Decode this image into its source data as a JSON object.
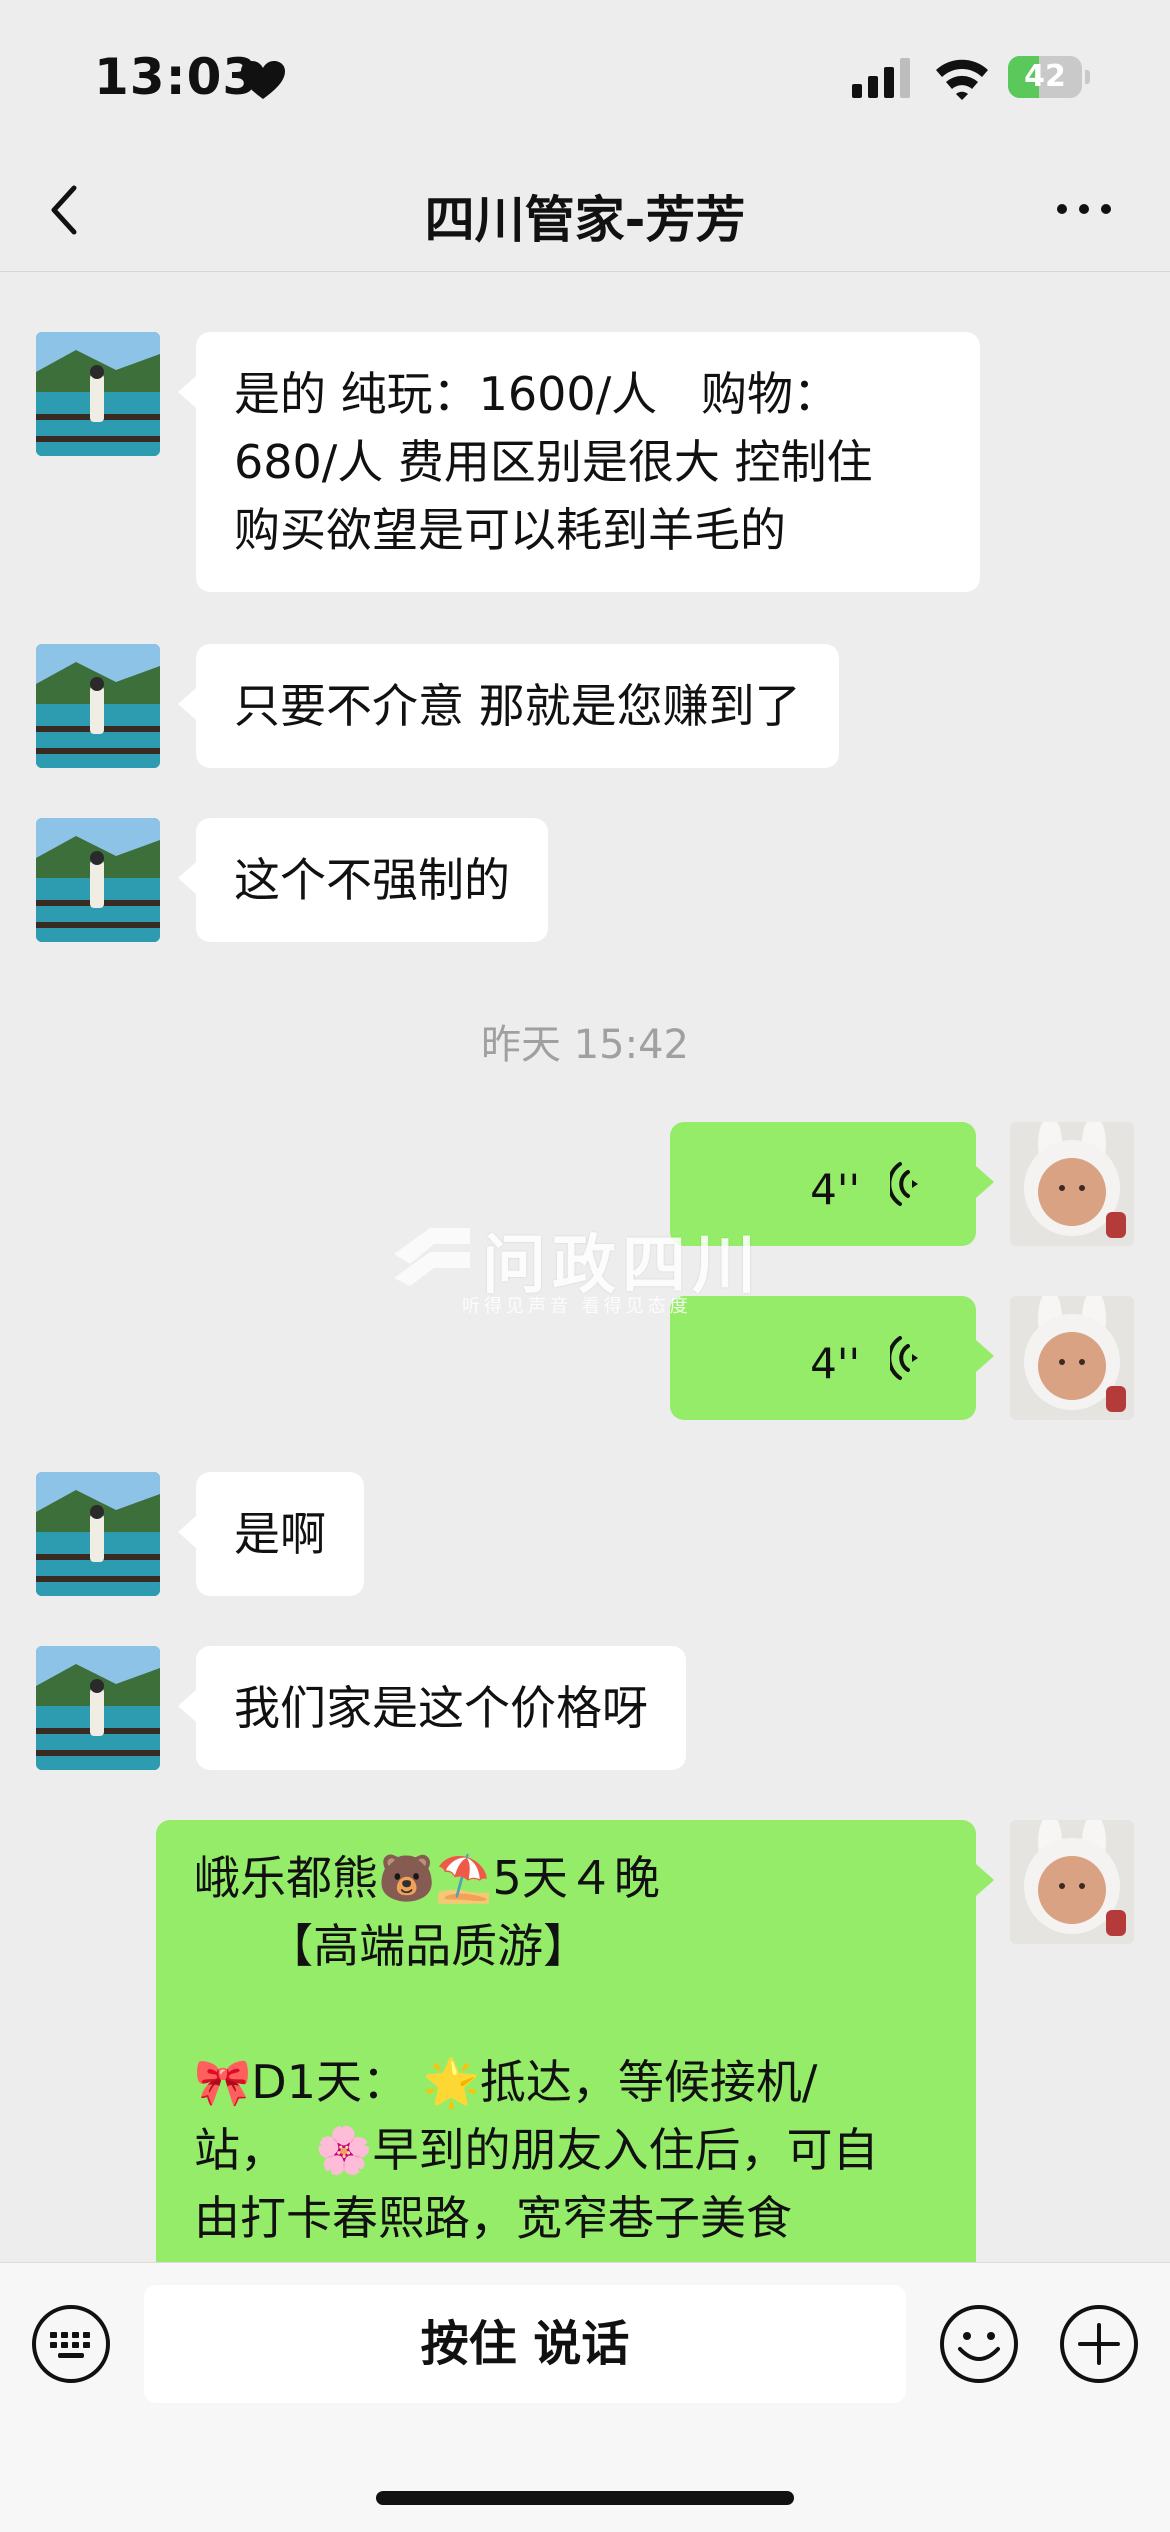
{
  "status_bar": {
    "time": "13:03",
    "battery": "42",
    "battery_level": 0.42
  },
  "nav": {
    "title": "四川管家-芳芳"
  },
  "messages": [
    {
      "from": "other",
      "text": "是的 纯玩：1600/人   购物：\n680/人 费用区别是很大 控制住\n购买欲望是可以耗到羊毛的"
    },
    {
      "from": "other",
      "text": "只要不介意 那就是您赚到了"
    },
    {
      "from": "other",
      "text": "这个不强制的"
    },
    {
      "type": "time",
      "text": "昨天 15:42"
    },
    {
      "from": "me",
      "type": "voice",
      "duration": "4''"
    },
    {
      "from": "me",
      "type": "voice",
      "duration": "4''"
    },
    {
      "from": "other",
      "text": "是啊"
    },
    {
      "from": "other",
      "text": "我们家是这个价格呀"
    },
    {
      "from": "me",
      "text": "峨乐都熊🐻⛱️5天４晚\n     【高端品质游】\n\n🎀D1天： 🌟抵达，等候接机/\n站，  🌸早到的朋友入住后，可自\n由打卡春熙路，宽窄巷子美食"
    }
  ],
  "watermark": {
    "title": "问政四川",
    "subtitle": "听得见声音  看得见态度"
  },
  "input": {
    "voice_label": "按住 说话"
  },
  "colors": {
    "outgoing_bubble": "#95ec69",
    "incoming_bubble": "#ffffff",
    "background": "#ededed"
  }
}
